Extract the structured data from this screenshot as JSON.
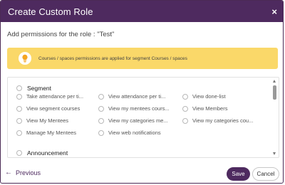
{
  "dialog": {
    "title": "Create Custom Role",
    "close_glyph": "×"
  },
  "intro_text": "Add permissions for the role : \"Test\"",
  "info_banner": {
    "icon": "lightbulb-icon",
    "text": "Courses / spaces permissions are applied for segment Courses / spaces",
    "color": "#fad869"
  },
  "permissions": {
    "segment": {
      "title": "Segment",
      "items": [
        "Take attendance per ti...",
        "View attendance per ti...",
        "View done-list",
        "View segment courses",
        "View my mentees cours...",
        "View Members",
        "View My Mentees",
        "View my categories me...",
        "View my categories cou...",
        "Manage My Mentees",
        "View web notifications"
      ]
    },
    "announcement": {
      "title": "Announcement"
    }
  },
  "footer": {
    "previous_label": "Previous",
    "save_label": "Save",
    "cancel_label": "Cancel"
  },
  "colors": {
    "header": "#4e2a5f",
    "primary_button": "#4e2a5f"
  }
}
